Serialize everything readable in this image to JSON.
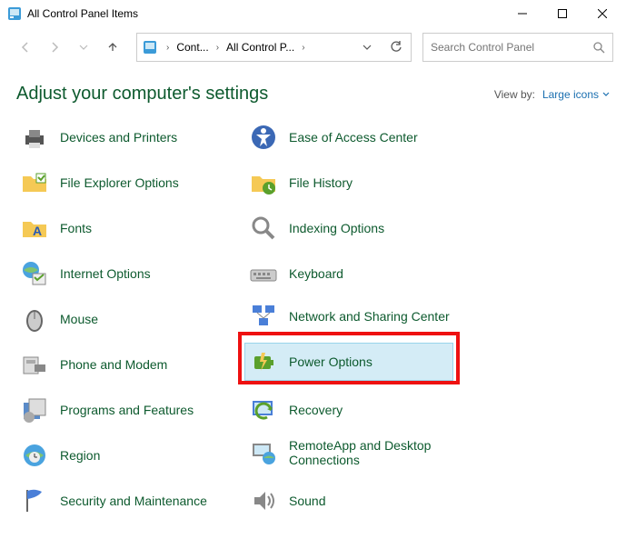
{
  "window": {
    "title": "All Control Panel Items"
  },
  "breadcrumb": {
    "first": "Cont...",
    "second": "All Control P..."
  },
  "search": {
    "placeholder": "Search Control Panel"
  },
  "header": {
    "title": "Adjust your computer's settings",
    "view_by_label": "View by:",
    "view_mode": "Large icons"
  },
  "items": {
    "left": [
      "Devices and Printers",
      "File Explorer Options",
      "Fonts",
      "Internet Options",
      "Mouse",
      "Phone and Modem",
      "Programs and Features",
      "Region",
      "Security and Maintenance"
    ],
    "right": [
      "Ease of Access Center",
      "File History",
      "Indexing Options",
      "Keyboard",
      "Network and Sharing Center",
      "Power Options",
      "Recovery",
      "RemoteApp and Desktop Connections",
      "Sound"
    ]
  },
  "selected_item": "Power Options",
  "colors": {
    "title_green": "#0d5a2e",
    "link_blue": "#1a6fb0",
    "highlight_red": "#e11",
    "selected_bg": "#d4ecf6"
  }
}
